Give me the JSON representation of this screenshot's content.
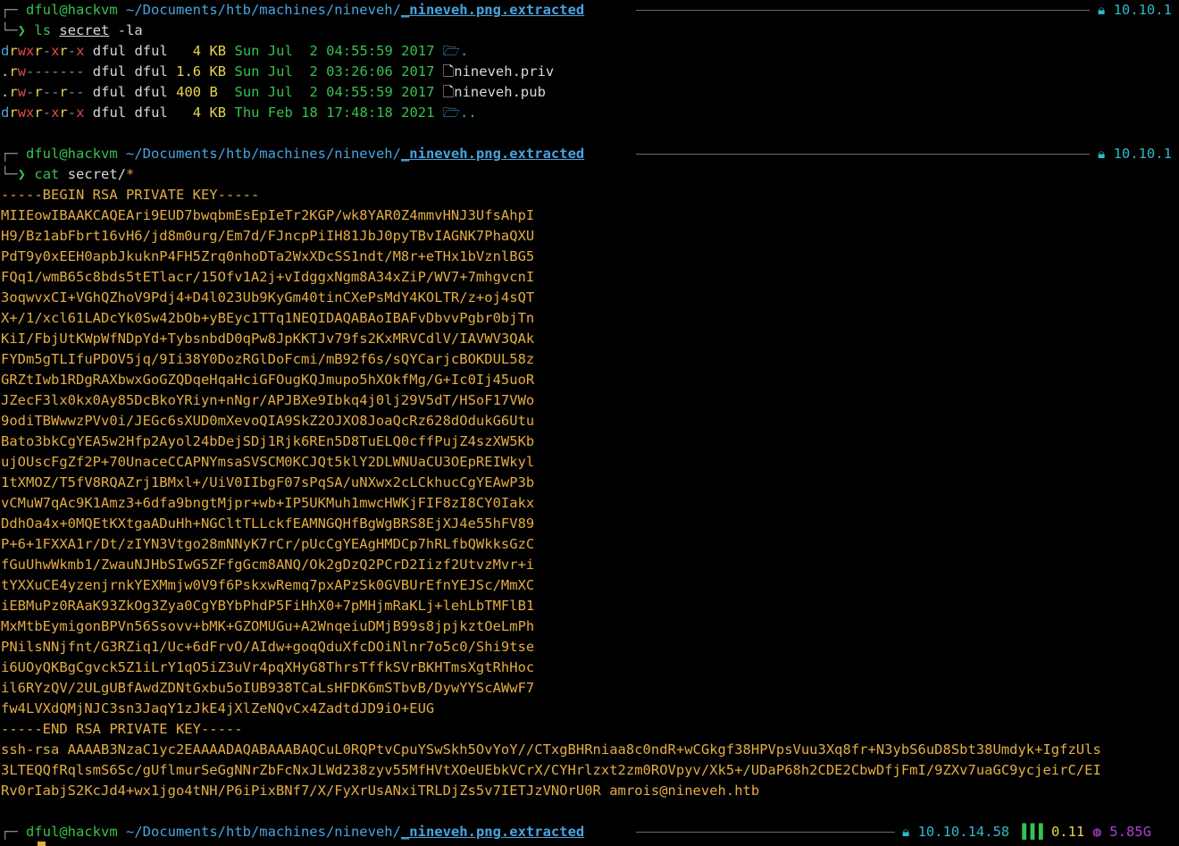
{
  "prompt": {
    "user_host": "dful@hackvm",
    "path_prefix": "~/Documents/htb/machines/nineveh/",
    "path_tail": "_nineveh.png.extracted",
    "ip_truncated": "10.10.1",
    "ip_full": "10.10.14.58",
    "load": "0.11",
    "mem": "5.85G"
  },
  "commands": {
    "cmd1": {
      "name": "ls",
      "arg": "secret",
      "flags": "-la"
    },
    "cmd2": {
      "name": "cat",
      "arg": "secret/",
      "glob": "*"
    }
  },
  "listing": [
    {
      "perms": [
        "d",
        "r",
        "w",
        "x",
        "r",
        "-",
        "x",
        "r",
        "-",
        "x"
      ],
      "user": "dful",
      "group": "dful",
      "size": "  4",
      "unit": "KB",
      "date": "Sun Jul  2 04:55:59 2017",
      "name": ".",
      "type": "folder"
    },
    {
      "perms": [
        ".",
        "r",
        "w",
        "-",
        "-",
        "-",
        "-",
        "-",
        "-",
        "-"
      ],
      "user": "dful",
      "group": "dful",
      "size": "1.6",
      "unit": "KB",
      "date": "Sun Jul  2 03:26:06 2017",
      "name": "nineveh.priv",
      "type": "file"
    },
    {
      "perms": [
        ".",
        "r",
        "w",
        "-",
        "r",
        "-",
        "-",
        "r",
        "-",
        "-"
      ],
      "user": "dful",
      "group": "dful",
      "size": "400",
      "unit": "B ",
      "date": "Sun Jul  2 04:55:59 2017",
      "name": "nineveh.pub",
      "type": "file"
    },
    {
      "perms": [
        "d",
        "r",
        "w",
        "x",
        "r",
        "-",
        "x",
        "r",
        "-",
        "x"
      ],
      "user": "dful",
      "group": "dful",
      "size": "  4",
      "unit": "KB",
      "date": "Thu Feb 18 17:48:18 2021",
      "name": "..",
      "type": "folder"
    }
  ],
  "key_lines": [
    "-----BEGIN RSA PRIVATE KEY-----",
    "MIIEowIBAAKCAQEAri9EUD7bwqbmEsEpIeTr2KGP/wk8YAR0Z4mmvHNJ3UfsAhpI",
    "H9/Bz1abFbrt16vH6/jd8m0urg/Em7d/FJncpPiIH81JbJ0pyTBvIAGNK7PhaQXU",
    "PdT9y0xEEH0apbJkuknP4FH5Zrq0nhoDTa2WxXDcSS1ndt/M8r+eTHx1bVznlBG5",
    "FQq1/wmB65c8bds5tETlacr/15Ofv1A2j+vIdggxNgm8A34xZiP/WV7+7mhgvcnI",
    "3oqwvxCI+VGhQZhoV9Pdj4+D4l023Ub9KyGm40tinCXePsMdY4KOLTR/z+oj4sQT",
    "X+/1/xcl61LADcYk0Sw42bOb+yBEyc1TTq1NEQIDAQABAoIBAFvDbvvPgbr0bjTn",
    "KiI/FbjUtKWpWfNDpYd+TybsnbdD0qPw8JpKKTJv79fs2KxMRVCdlV/IAVWV3QAk",
    "FYDm5gTLIfuPDOV5jq/9Ii38Y0DozRGlDoFcmi/mB92f6s/sQYCarjcBOKDUL58z",
    "GRZtIwb1RDgRAXbwxGoGZQDqeHqaHciGFOugKQJmupo5hXOkfMg/G+Ic0Ij45uoR",
    "JZecF3lx0kx0Ay85DcBkoYRiyn+nNgr/APJBXe9Ibkq4j0lj29V5dT/HSoF17VWo",
    "9odiTBWwwzPVv0i/JEGc6sXUD0mXevoQIA9SkZ2OJXO8JoaQcRz628dOdukG6Utu",
    "Bato3bkCgYEA5w2Hfp2Ayol24bDejSDj1Rjk6REn5D8TuELQ0cffPujZ4szXW5Kb",
    "ujOUscFgZf2P+70UnaceCCAPNYmsaSVSCM0KCJQt5klY2DLWNUaCU3OEpREIWkyl",
    "1tXMOZ/T5fV8RQAZrj1BMxl+/UiV0IIbgF07sPqSA/uNXwx2cLCkhucCgYEAwP3b",
    "vCMuW7qAc9K1Amz3+6dfa9bngtMjpr+wb+IP5UKMuh1mwcHWKjFIF8zI8CY0Iakx",
    "DdhOa4x+0MQEtKXtgaADuHh+NGCltTLLckfEAMNGQHfBgWgBRS8EjXJ4e55hFV89",
    "P+6+1FXXA1r/Dt/zIYN3Vtgo28mNNyK7rCr/pUcCgYEAgHMDCp7hRLfbQWkksGzC",
    "fGuUhwWkmb1/ZwauNJHbSIwG5ZFfgGcm8ANQ/Ok2gDzQ2PCrD2Iizf2UtvzMvr+i",
    "tYXXuCE4yzenjrnkYEXMmjw0V9f6PskxwRemq7pxAPzSk0GVBUrEfnYEJSc/MmXC",
    "iEBMuPz0RAaK93ZkOg3Zya0CgYBYbPhdP5FiHhX0+7pMHjmRaKLj+lehLbTMFlB1",
    "MxMtbEymigonBPVn56Ssovv+bMK+GZOMUGu+A2WnqeiuDMjB99s8jpjkztOeLmPh",
    "PNilsNNjfnt/G3RZiq1/Uc+6dFrvO/AIdw+goqQduXfcDOiNlnr7o5c0/Shi9tse",
    "i6UOyQKBgCgvck5Z1iLrY1qO5iZ3uVr4pqXHyG8ThrsTffkSVrBKHTmsXgtRhHoc",
    "il6RYzQV/2ULgUBfAwdZDNtGxbu5oIUB938TCaLsHFDK6mSTbvB/DywYYScAWwF7",
    "fw4LVXdQMjNJC3sn3JaqY1zJkE4jXlZeNQvCx4ZadtdJD9iO+EUG",
    "-----END RSA PRIVATE KEY-----",
    "ssh-rsa AAAAB3NzaC1yc2EAAAADAQABAAABAQCuL0RQPtvCpuYSwSkh5OvYoY//CTxgBHRniaa8c0ndR+wCGkgf38HPVpsVuu3Xq8fr+N3ybS6uD8Sbt38Umdyk+IgfzUls",
    "3LTEQQfRqlsmS6Sc/gUflmurSeGgNNrZbFcNxJLWd238zyv55MfHVtXOeUEbkVCrX/CYHrlzxt2zm0ROVpyv/Xk5+/UDaP68h2CDE2CbwDfjFmI/9ZXv7uaGC9ycjeirC/EI",
    "Rv0rIabjS2KcJd4+wx1jgo4tNH/P6iPixBNf7/X/FyXrUsANxiTRLDjZs5v7IETJzVNOrU0R amrois@nineveh.htb"
  ]
}
